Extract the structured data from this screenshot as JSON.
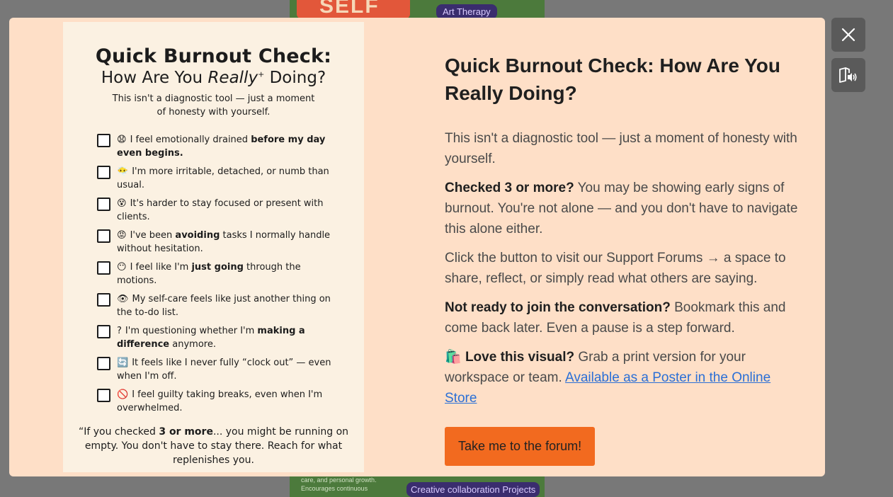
{
  "background": {
    "art_word": "SELF",
    "tag_top": "Art Therapy",
    "footer_text_1": "care, and personal growth.",
    "footer_text_2": "Encourages continuous",
    "tag_bottom": "Creative collaboration Projects"
  },
  "poster": {
    "title": "Quick Burnout Check:",
    "subtitle_before": "How Are You ",
    "subtitle_em": "Really",
    "subtitle_sup": "+",
    "subtitle_after": " Doing?",
    "intro": "This isn't a diagnostic tool — just a moment of honesty with yourself.",
    "items": [
      {
        "emoji": "😧",
        "pre": "I feel emotionally drained ",
        "bold": "before my day even begins.",
        "post": ""
      },
      {
        "emoji": "😶‍🌫️",
        "pre": "I'm more irritable, detached, or numb than usual.",
        "bold": "",
        "post": ""
      },
      {
        "emoji": "😵",
        "pre": "It's harder to stay focused or present with clients.",
        "bold": "",
        "post": ""
      },
      {
        "emoji": "😡",
        "pre": "I've been ",
        "bold": "avoiding",
        "post": " tasks I normally handle without hesitation."
      },
      {
        "emoji": "😶",
        "pre": "I feel like I'm ",
        "bold": "just going",
        "post": " through the motions."
      },
      {
        "emoji": "👁",
        "pre": "My self-care feels like just another thing on the to-do list.",
        "bold": "",
        "post": ""
      },
      {
        "emoji": "?",
        "pre": "I'm questioning whether I'm ",
        "bold": "making a difference",
        "post": " anymore."
      },
      {
        "emoji": "🔄",
        "pre": "It feels like I never fully “clock out” — even when I'm off.",
        "bold": "",
        "post": ""
      },
      {
        "emoji": "🚫",
        "pre": "I feel guilty taking breaks, even when I'm overwhelmed.",
        "bold": "",
        "post": ""
      }
    ],
    "quote_open": "“If you checked ",
    "quote_bold": "3 or more",
    "quote_rest": "... you might be running on empty. You don't have to stay there. Reach for what replenishes you."
  },
  "content": {
    "heading": "Quick Burnout Check: How Are You Really Doing?",
    "p1": "This isn't a diagnostic tool — just a moment of honesty with yourself.",
    "p2_bold": "Checked 3 or more?",
    "p2_rest": " You may be showing early signs of burnout. You're not alone — and you don't have to navigate this alone either.",
    "p3": "Click the button to visit our Support Forums → a space to share, reflect, or simply read what others are saying.",
    "p4_bold": "Not ready to join the conversation?",
    "p4_rest": " Bookmark this and come back later. Even a pause is a step forward.",
    "p5_emoji": "🛍️",
    "p5_bold": " Love this visual?",
    "p5_rest": " Grab a print version for your workspace or team. ",
    "p5_link": "Available as a Poster in the Online Store",
    "button_label": "Take me to the forum!"
  },
  "icons": {
    "close": "close-icon",
    "audio": "read-aloud-icon"
  }
}
